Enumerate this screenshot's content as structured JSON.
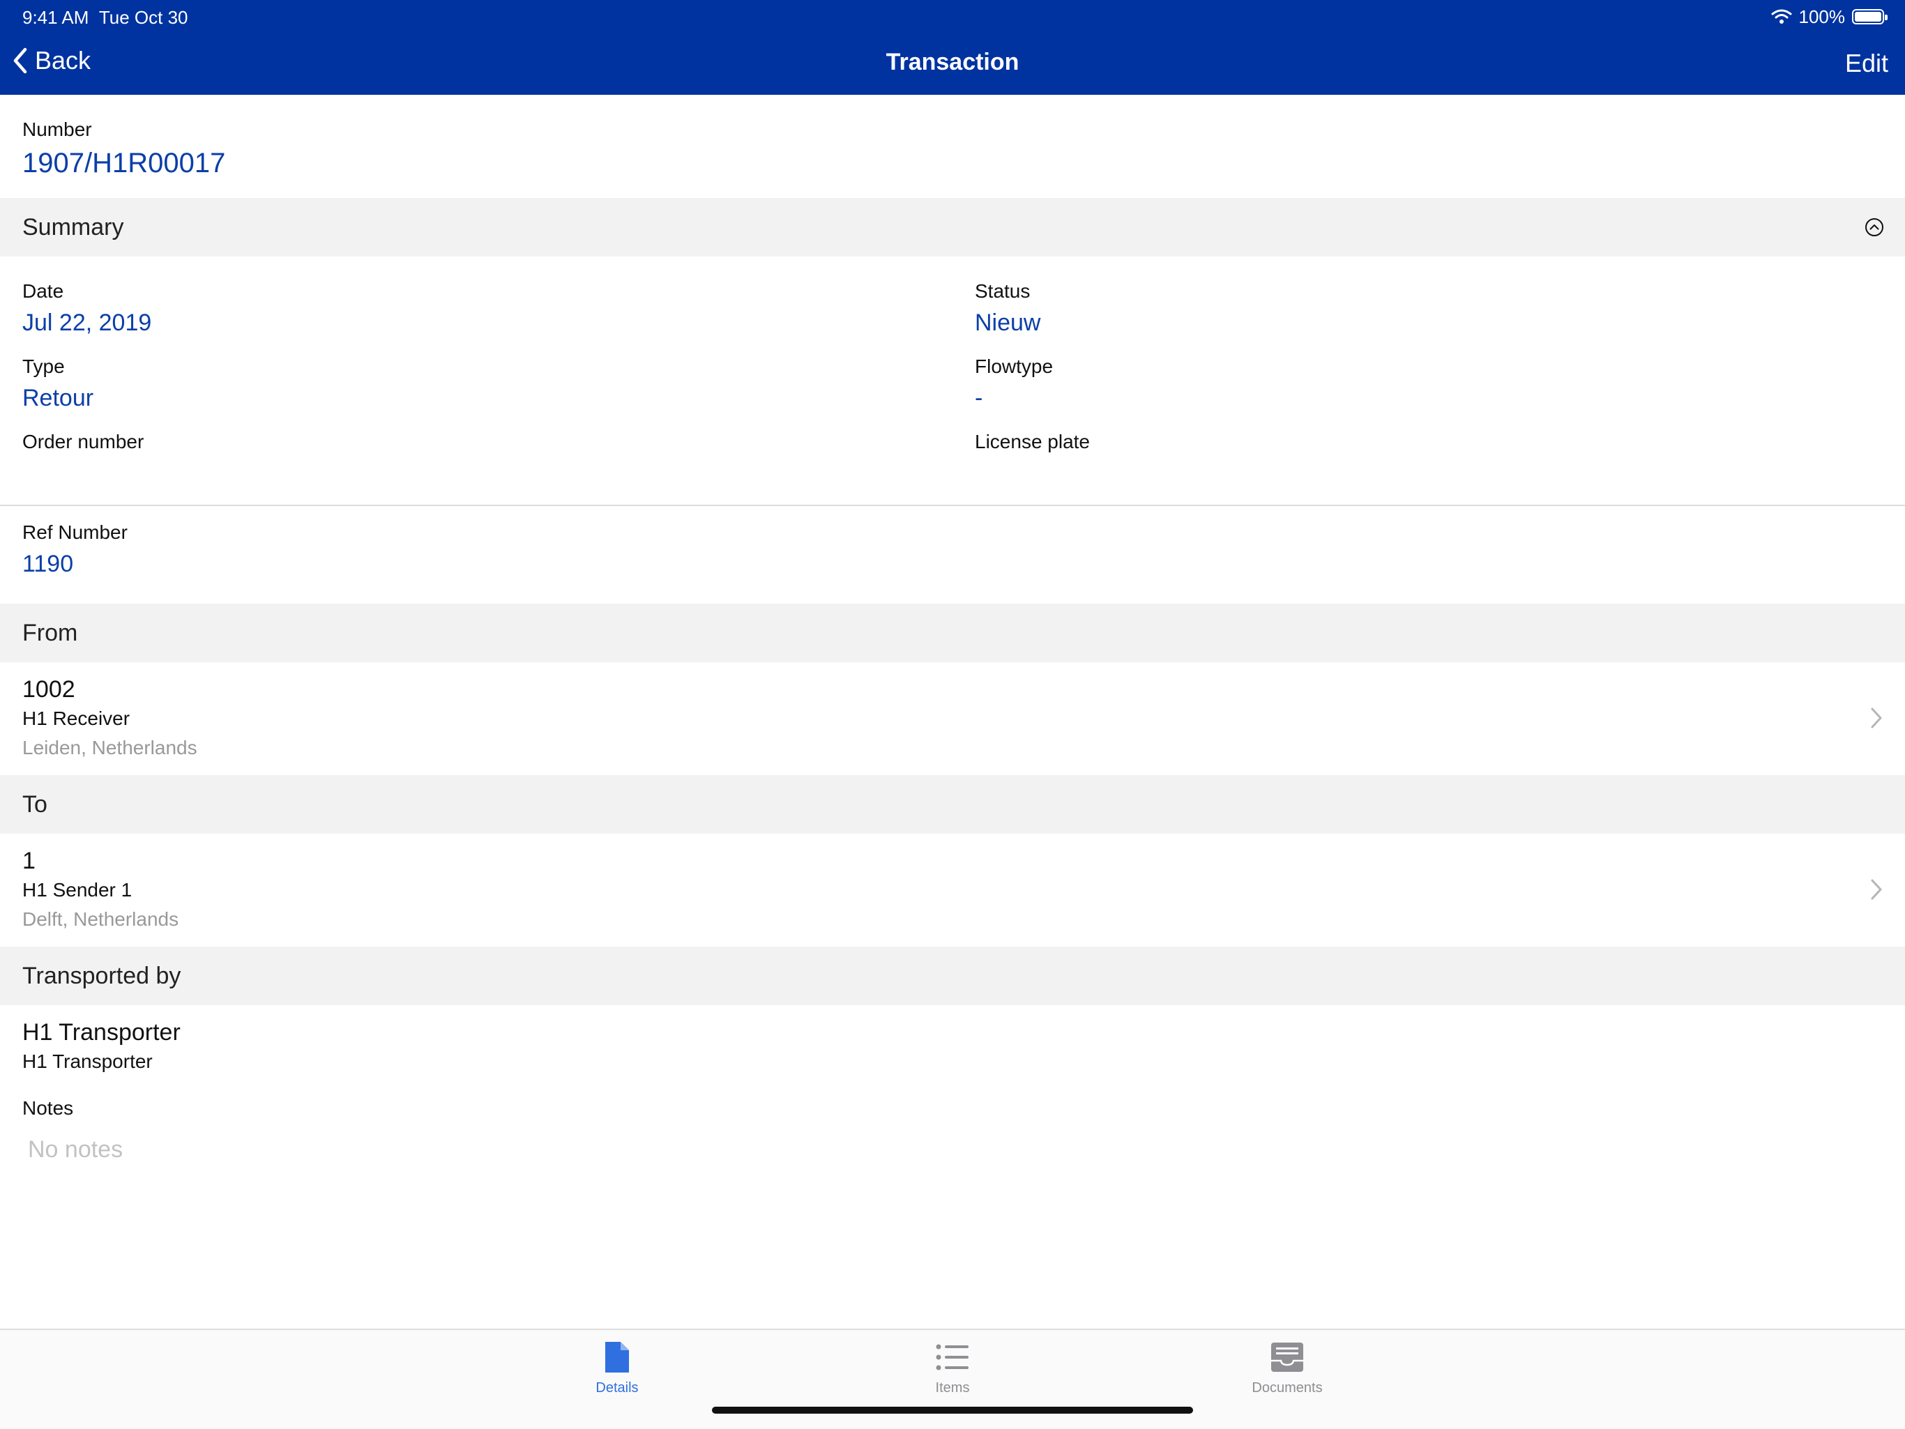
{
  "status_bar": {
    "time": "9:41 AM",
    "date": "Tue Oct 30",
    "battery": "100%",
    "battery_level": 1.0
  },
  "nav": {
    "back_label": "Back",
    "title": "Transaction",
    "edit_label": "Edit"
  },
  "number": {
    "label": "Number",
    "value": "1907/H1R00017"
  },
  "summary": {
    "header": "Summary",
    "fields": {
      "date": {
        "label": "Date",
        "value": "Jul 22, 2019"
      },
      "status": {
        "label": "Status",
        "value": "Nieuw"
      },
      "type": {
        "label": "Type",
        "value": "Retour"
      },
      "flowtype": {
        "label": "Flowtype",
        "value": "-"
      },
      "order_number": {
        "label": "Order number",
        "value": ""
      },
      "license_plate": {
        "label": "License plate",
        "value": ""
      }
    }
  },
  "ref_number": {
    "label": "Ref Number",
    "value": "1190"
  },
  "from": {
    "header": "From",
    "id": "1002",
    "name": "H1 Receiver",
    "location": "Leiden, Netherlands"
  },
  "to": {
    "header": "To",
    "id": "1",
    "name": "H1 Sender 1",
    "location": "Delft, Netherlands"
  },
  "transported_by": {
    "header": "Transported by",
    "name": "H1 Transporter",
    "sub": "H1 Transporter"
  },
  "notes": {
    "label": "Notes",
    "empty_text": "No notes"
  },
  "tabs": [
    {
      "label": "Details",
      "icon": "document-icon",
      "active": true
    },
    {
      "label": "Items",
      "icon": "list-icon",
      "active": false
    },
    {
      "label": "Documents",
      "icon": "inbox-icon",
      "active": false
    }
  ],
  "colors": {
    "nav_bar": "#0033a0",
    "value_text": "#0b3fa8",
    "tab_active": "#2f6fe0",
    "section_bg": "#f2f2f2"
  }
}
